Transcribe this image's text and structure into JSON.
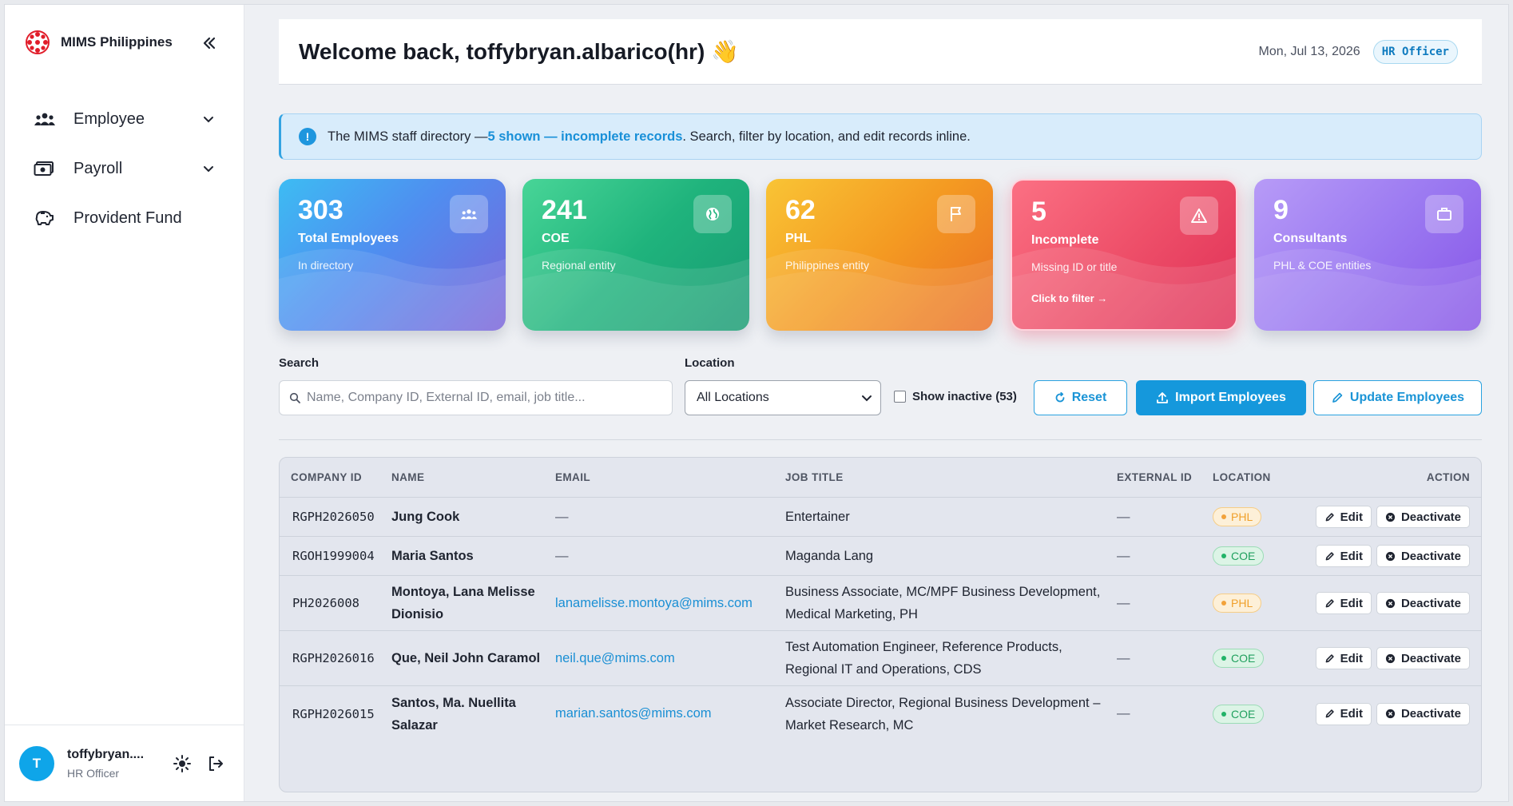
{
  "app": {
    "brand_name": "MIMS Philippines",
    "brand_color": "#e11d2a"
  },
  "sidebar": {
    "items": [
      {
        "label": "Employee",
        "icon": "users-icon",
        "has_submenu": true
      },
      {
        "label": "Payroll",
        "icon": "money-icon",
        "has_submenu": true
      },
      {
        "label": "Provident Fund",
        "icon": "piggy-bank-icon",
        "has_submenu": false
      }
    ],
    "user": {
      "initial": "T",
      "name": "toffybryan....",
      "role": "HR Officer"
    }
  },
  "header": {
    "welcome": "Welcome back, toffybryan.albarico(hr) 👋",
    "date": "Mon, Jul 13, 2026",
    "role_pill": "HR Officer"
  },
  "banner": {
    "prefix": "The MIMS staff directory — ",
    "link": "5 shown — incomplete records",
    "suffix": ". Search, filter by location, and edit records inline."
  },
  "stats": [
    {
      "value": "303",
      "title": "Total Employees",
      "sub": "In directory",
      "icon": "users-icon",
      "color": "#4f8ef0"
    },
    {
      "value": "241",
      "title": "COE",
      "sub": "Regional entity",
      "icon": "globe-icon",
      "color": "#1fb37c"
    },
    {
      "value": "62",
      "title": "PHL",
      "sub": "Philippines entity",
      "icon": "flag-icon",
      "color": "#f49a22"
    },
    {
      "value": "5",
      "title": "Incomplete",
      "sub": "Missing ID or title",
      "cta": "Click to filter →",
      "icon": "warning-icon",
      "color": "#ee4f69"
    },
    {
      "value": "9",
      "title": "Consultants",
      "sub": "PHL & COE entities",
      "icon": "briefcase-icon",
      "color": "#9b79f1"
    }
  ],
  "filters": {
    "search_label": "Search",
    "search_placeholder": "Name, Company ID, External ID, email, job title...",
    "search_value": "",
    "location_label": "Location",
    "location_selected": "All Locations",
    "show_inactive_label": "Show inactive (53)",
    "show_inactive_checked": false,
    "reset_label": "Reset",
    "import_label": "Import Employees",
    "update_label": "Update Employees"
  },
  "table": {
    "columns": [
      "COMPANY ID",
      "NAME",
      "EMAIL",
      "JOB TITLE",
      "EXTERNAL ID",
      "LOCATION",
      "ACTION"
    ],
    "rows": [
      {
        "company_id": "RGPH2026050",
        "name": "Jung Cook",
        "email": "—",
        "job_title": "Entertainer",
        "external_id": "—",
        "location": "PHL"
      },
      {
        "company_id": "RGOH1999004",
        "name": "Maria Santos",
        "email": "—",
        "job_title": "Maganda Lang",
        "external_id": "—",
        "location": "COE"
      },
      {
        "company_id": "PH2026008",
        "name": "Montoya, Lana Melisse Dionisio",
        "email": "lanamelisse.montoya@mims.com",
        "job_title": "Business Associate, MC/MPF Business Development, Medical Marketing, PH",
        "external_id": "—",
        "location": "PHL"
      },
      {
        "company_id": "RGPH2026016",
        "name": "Que, Neil John Caramol",
        "email": "neil.que@mims.com",
        "job_title": "Test Automation Engineer, Reference Products, Regional IT and Operations, CDS",
        "external_id": "—",
        "location": "COE"
      },
      {
        "company_id": "RGPH2026015",
        "name": "Santos, Ma. Nuellita Salazar",
        "email": "marian.santos@mims.com",
        "job_title": "Associate Director, Regional Business Development – Market Research, MC",
        "external_id": "—",
        "location": "COE"
      }
    ],
    "edit_label": "Edit",
    "deactivate_label": "Deactivate"
  }
}
